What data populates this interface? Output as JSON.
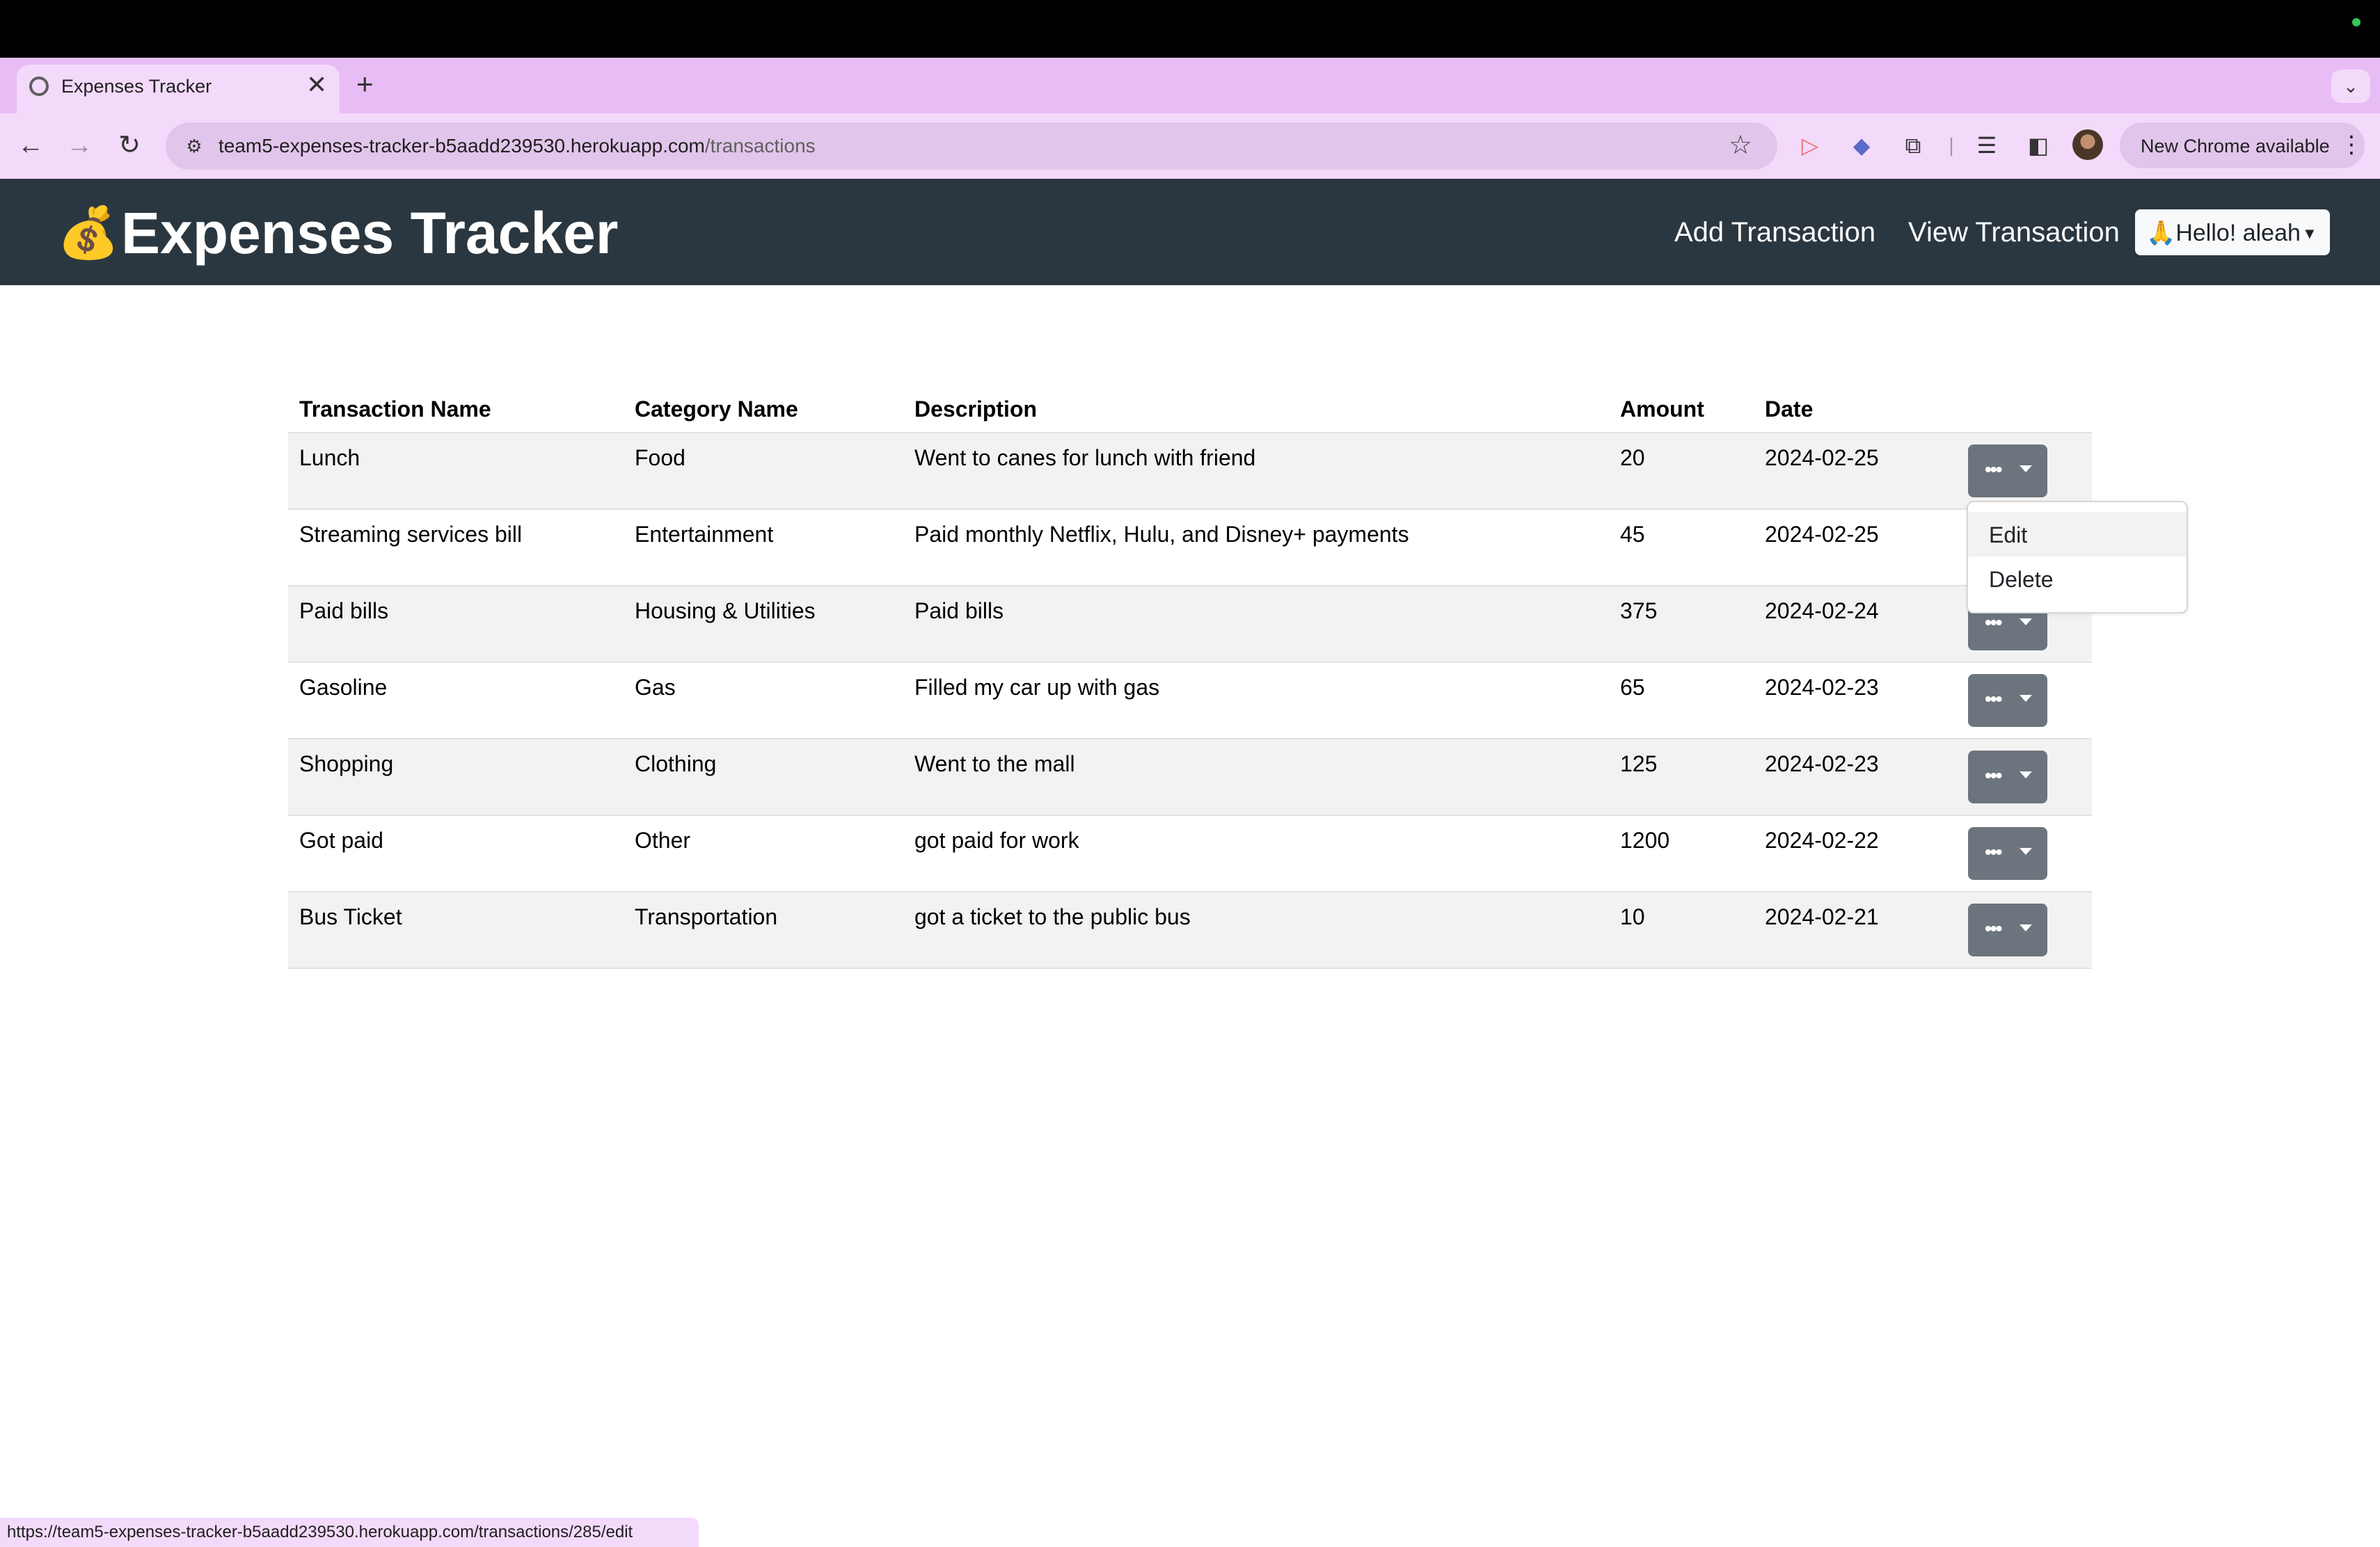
{
  "browser": {
    "tab_title": "Expenses Tracker",
    "tab_close": "✕",
    "new_tab": "+",
    "tab_search": "⌄",
    "back": "←",
    "forward": "→",
    "reload": "↻",
    "url_host": "team5-expenses-tracker-b5aadd239530.herokuapp.com",
    "url_path": "/transactions",
    "update_label": "New Chrome available",
    "update_menu": "⋮",
    "status_url": "https://team5-expenses-tracker-b5aadd239530.herokuapp.com/transactions/285/edit"
  },
  "navbar": {
    "brand_icon": "💰",
    "brand": "Expenses Tracker",
    "links": [
      "Add Transaction",
      "View Transaction"
    ],
    "user_greeting": "🙏Hello! aleah"
  },
  "table": {
    "headers": [
      "Transaction Name",
      "Category Name",
      "Description",
      "Amount",
      "Date"
    ],
    "rows": [
      [
        "Lunch",
        "Food",
        "Went to canes for lunch with friend",
        "20",
        "2024-02-25"
      ],
      [
        "Streaming services bill",
        "Entertainment",
        "Paid monthly Netflix, Hulu, and Disney+ payments",
        "45",
        "2024-02-25"
      ],
      [
        "Paid bills",
        "Housing & Utilities",
        "Paid bills",
        "375",
        "2024-02-24"
      ],
      [
        "Gasoline",
        "Gas",
        "Filled my car up with gas",
        "65",
        "2024-02-23"
      ],
      [
        "Shopping",
        "Clothing",
        "Went to the mall",
        "125",
        "2024-02-23"
      ],
      [
        "Got paid",
        "Other",
        "got paid for work",
        "1200",
        "2024-02-22"
      ],
      [
        "Bus Ticket",
        "Transportation",
        "got a ticket to the public bus",
        "10",
        "2024-02-21"
      ]
    ],
    "action_dots": "•••"
  },
  "dropdown": {
    "items": [
      "Edit",
      "Delete"
    ]
  },
  "colors": {
    "navbar_bg": "#2b3740",
    "action_btn": "#6c757d",
    "chrome_accent": "#e8bdf5"
  }
}
